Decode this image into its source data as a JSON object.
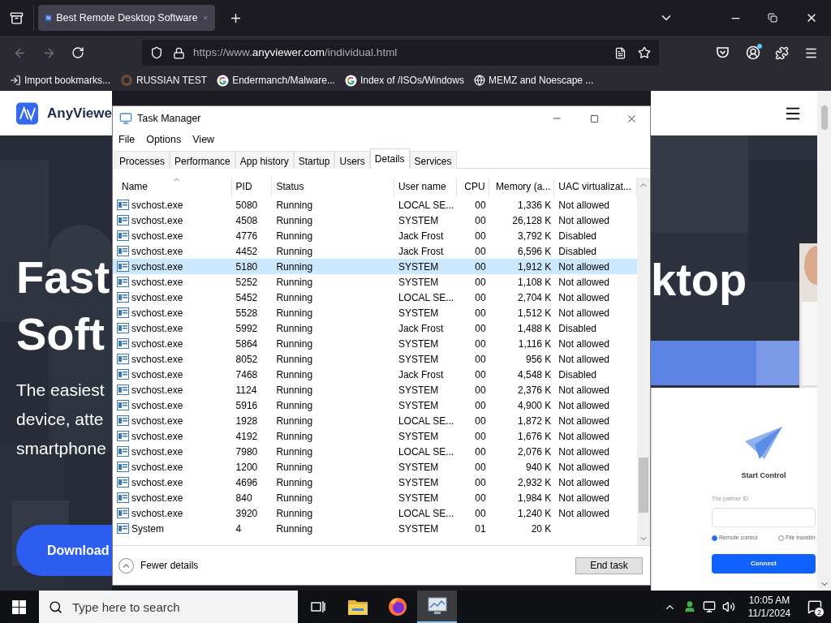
{
  "browser": {
    "tab": {
      "title": "Best Remote Desktop Software",
      "selected": true
    },
    "url": {
      "prefix": "https://www.",
      "domain": "anyviewer.com",
      "path": "/individual.html"
    },
    "bookmarks": [
      {
        "kind": "import",
        "label": "Import bookmarks..."
      },
      {
        "kind": "site",
        "label": "RUSSIAN TEST"
      },
      {
        "kind": "google",
        "label": "Endermanch/Malware..."
      },
      {
        "kind": "google",
        "label": "Index of /ISOs/Windows"
      },
      {
        "kind": "globe",
        "label": "MEMZ and Noescape ..."
      }
    ]
  },
  "webpage": {
    "brand": "AnyViewe",
    "heading_left": [
      "Fast",
      "Soft"
    ],
    "heading_right": "ktop",
    "intro_lines": [
      "The easiest",
      "device, atte",
      "smartphone"
    ],
    "download_button": "Download",
    "card": {
      "title": "Start Control",
      "field_label": "The partner ID",
      "modes": [
        {
          "label": "Remote control",
          "selected": true
        },
        {
          "label": "File transfer",
          "selected": false
        }
      ],
      "connect_button": "Connect"
    }
  },
  "task_manager": {
    "title": "Task Manager",
    "menu": [
      "File",
      "Options",
      "View"
    ],
    "tabs": [
      {
        "label": "Processes",
        "selected": false
      },
      {
        "label": "Performance",
        "selected": false
      },
      {
        "label": "App history",
        "selected": false
      },
      {
        "label": "Startup",
        "selected": false
      },
      {
        "label": "Users",
        "selected": false
      },
      {
        "label": "Details",
        "selected": true
      },
      {
        "label": "Services",
        "selected": false
      }
    ],
    "columns": [
      {
        "label": "Name",
        "sorted": true
      },
      {
        "label": "PID",
        "sorted": false
      },
      {
        "label": "Status",
        "sorted": false
      },
      {
        "label": "User name",
        "sorted": false
      },
      {
        "label": "CPU",
        "sorted": false
      },
      {
        "label": "Memory (a...",
        "sorted": false
      },
      {
        "label": "UAC virtualizat...",
        "sorted": false
      }
    ],
    "rows": [
      {
        "name": "svchost.exe",
        "pid": "5080",
        "status": "Running",
        "user": "LOCAL SE...",
        "cpu": "00",
        "memory": "1,336 K",
        "uac": "Not allowed",
        "selected": false
      },
      {
        "name": "svchost.exe",
        "pid": "4508",
        "status": "Running",
        "user": "SYSTEM",
        "cpu": "00",
        "memory": "26,128 K",
        "uac": "Not allowed",
        "selected": false
      },
      {
        "name": "svchost.exe",
        "pid": "4776",
        "status": "Running",
        "user": "Jack Frost",
        "cpu": "00",
        "memory": "3,792 K",
        "uac": "Disabled",
        "selected": false
      },
      {
        "name": "svchost.exe",
        "pid": "4452",
        "status": "Running",
        "user": "Jack Frost",
        "cpu": "00",
        "memory": "6,596 K",
        "uac": "Disabled",
        "selected": false
      },
      {
        "name": "svchost.exe",
        "pid": "5180",
        "status": "Running",
        "user": "SYSTEM",
        "cpu": "00",
        "memory": "1,912 K",
        "uac": "Not allowed",
        "selected": true
      },
      {
        "name": "svchost.exe",
        "pid": "5252",
        "status": "Running",
        "user": "SYSTEM",
        "cpu": "00",
        "memory": "1,108 K",
        "uac": "Not allowed",
        "selected": false
      },
      {
        "name": "svchost.exe",
        "pid": "5452",
        "status": "Running",
        "user": "LOCAL SE...",
        "cpu": "00",
        "memory": "2,704 K",
        "uac": "Not allowed",
        "selected": false
      },
      {
        "name": "svchost.exe",
        "pid": "5528",
        "status": "Running",
        "user": "SYSTEM",
        "cpu": "00",
        "memory": "1,512 K",
        "uac": "Not allowed",
        "selected": false
      },
      {
        "name": "svchost.exe",
        "pid": "5992",
        "status": "Running",
        "user": "Jack Frost",
        "cpu": "00",
        "memory": "1,488 K",
        "uac": "Disabled",
        "selected": false
      },
      {
        "name": "svchost.exe",
        "pid": "5864",
        "status": "Running",
        "user": "SYSTEM",
        "cpu": "00",
        "memory": "1,116 K",
        "uac": "Not allowed",
        "selected": false
      },
      {
        "name": "svchost.exe",
        "pid": "8052",
        "status": "Running",
        "user": "SYSTEM",
        "cpu": "00",
        "memory": "956 K",
        "uac": "Not allowed",
        "selected": false
      },
      {
        "name": "svchost.exe",
        "pid": "7468",
        "status": "Running",
        "user": "Jack Frost",
        "cpu": "00",
        "memory": "4,548 K",
        "uac": "Disabled",
        "selected": false
      },
      {
        "name": "svchost.exe",
        "pid": "1124",
        "status": "Running",
        "user": "SYSTEM",
        "cpu": "00",
        "memory": "2,376 K",
        "uac": "Not allowed",
        "selected": false
      },
      {
        "name": "svchost.exe",
        "pid": "5916",
        "status": "Running",
        "user": "SYSTEM",
        "cpu": "00",
        "memory": "4,900 K",
        "uac": "Not allowed",
        "selected": false
      },
      {
        "name": "svchost.exe",
        "pid": "1928",
        "status": "Running",
        "user": "LOCAL SE...",
        "cpu": "00",
        "memory": "1,872 K",
        "uac": "Not allowed",
        "selected": false
      },
      {
        "name": "svchost.exe",
        "pid": "4192",
        "status": "Running",
        "user": "SYSTEM",
        "cpu": "00",
        "memory": "1,676 K",
        "uac": "Not allowed",
        "selected": false
      },
      {
        "name": "svchost.exe",
        "pid": "7980",
        "status": "Running",
        "user": "LOCAL SE...",
        "cpu": "00",
        "memory": "2,076 K",
        "uac": "Not allowed",
        "selected": false
      },
      {
        "name": "svchost.exe",
        "pid": "1200",
        "status": "Running",
        "user": "SYSTEM",
        "cpu": "00",
        "memory": "940 K",
        "uac": "Not allowed",
        "selected": false
      },
      {
        "name": "svchost.exe",
        "pid": "4696",
        "status": "Running",
        "user": "SYSTEM",
        "cpu": "00",
        "memory": "2,932 K",
        "uac": "Not allowed",
        "selected": false
      },
      {
        "name": "svchost.exe",
        "pid": "840",
        "status": "Running",
        "user": "SYSTEM",
        "cpu": "00",
        "memory": "1,984 K",
        "uac": "Not allowed",
        "selected": false
      },
      {
        "name": "svchost.exe",
        "pid": "3920",
        "status": "Running",
        "user": "LOCAL SE...",
        "cpu": "00",
        "memory": "1,240 K",
        "uac": "Not allowed",
        "selected": false
      },
      {
        "name": "System",
        "pid": "4",
        "status": "Running",
        "user": "SYSTEM",
        "cpu": "01",
        "memory": "20 K",
        "selected": false
      }
    ],
    "footer": {
      "toggle": "Fewer details",
      "end_task_button": "End task"
    }
  },
  "taskbar": {
    "search": {
      "placeholder": "Type here to search"
    },
    "apps": [
      {
        "kind": "task_view",
        "selected": false
      },
      {
        "kind": "explorer",
        "selected": false
      },
      {
        "kind": "firefox",
        "selected": false
      },
      {
        "kind": "task_manager",
        "selected": true
      }
    ],
    "tray": {
      "time": "10:05 AM",
      "date": "11/1/2024",
      "notifications": "2"
    }
  }
}
